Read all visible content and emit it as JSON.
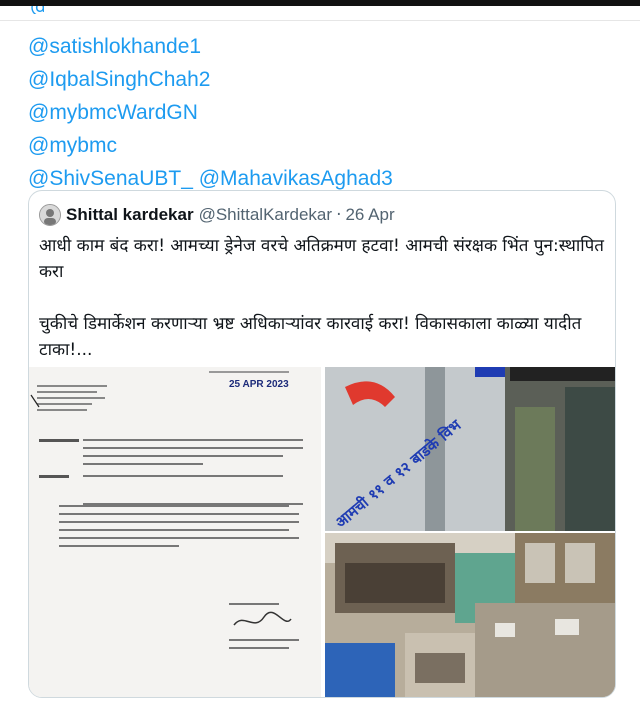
{
  "mentions": [
    "@satishlokhande1",
    "@IqbalSinghChah2",
    "@mybmcWardGN",
    "@mybmc",
    "@ShivSenaUBT_ @MahavikasAghad3"
  ],
  "quoted_post": {
    "author_name": "Shittal kardekar",
    "author_handle": "@ShittalKardekar",
    "separator": "·",
    "date": "26 Apr",
    "text_line1": "आधी काम बंद करा! आमच्या ड्रेनेज वरचे अतिक्रमण हटवा! आमची संरक्षक भिंत पुन:स्थापित करा",
    "text_line2": "चुकीचे डिमार्केशन करणाऱ्या भ्रष्ट अधिकाऱ्यांवर कारवाई करा! विकासकाला काळ्या यादीत टाका!..."
  },
  "media": {
    "document_stamp_date": "25 APR 2023",
    "wall_marking": "आमची ११ व १२ बाडके विभ"
  }
}
